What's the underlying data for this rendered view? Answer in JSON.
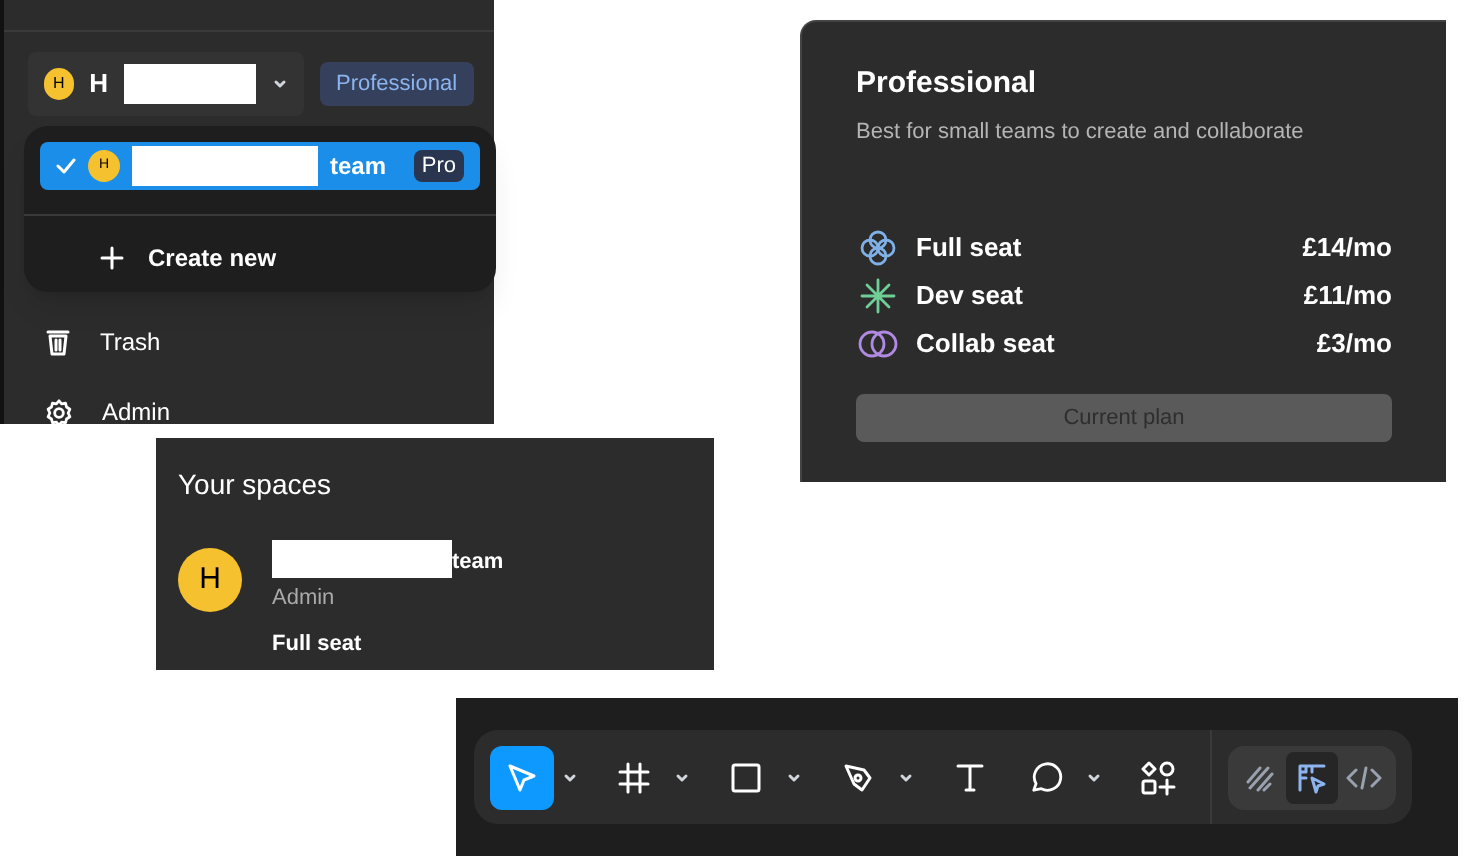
{
  "sidebar_panel": {
    "workspace": {
      "avatar": "H",
      "name": "H",
      "plan_badge": "Professional"
    },
    "menu": {
      "items": [
        {
          "avatar": "H",
          "name": "team",
          "badge": "Pro",
          "selected": true
        }
      ],
      "create_label": "Create new"
    },
    "nav": [
      {
        "kind": "trash",
        "label": "Trash"
      },
      {
        "kind": "gear",
        "label": "Admin"
      }
    ]
  },
  "plan_card": {
    "title": "Professional",
    "subtitle": "Best for small teams to create and collaborate",
    "seats": [
      {
        "kind": "full",
        "label": "Full seat",
        "price": "£14/mo"
      },
      {
        "kind": "dev",
        "label": "Dev seat",
        "price": "£11/mo"
      },
      {
        "kind": "collab",
        "label": "Collab seat",
        "price": "£3/mo"
      }
    ],
    "button": {
      "label": "Current plan",
      "disabled": true
    }
  },
  "spaces": {
    "title": "Your spaces",
    "items": [
      {
        "avatar": "H",
        "name": "team",
        "role": "Admin",
        "seat": "Full seat"
      }
    ]
  },
  "toolbar": {
    "tools": [
      {
        "kind": "move",
        "selected": true,
        "dropdown": true
      },
      {
        "kind": "frame",
        "selected": false,
        "dropdown": true
      },
      {
        "kind": "shape",
        "selected": false,
        "dropdown": true
      },
      {
        "kind": "pen",
        "selected": false,
        "dropdown": true
      },
      {
        "kind": "text",
        "selected": false,
        "dropdown": false
      },
      {
        "kind": "comment",
        "selected": false,
        "dropdown": true
      },
      {
        "kind": "actions",
        "selected": false,
        "dropdown": false
      }
    ],
    "modes": [
      {
        "kind": "draw",
        "selected": false
      },
      {
        "kind": "design",
        "selected": true
      },
      {
        "kind": "dev",
        "selected": false
      }
    ]
  }
}
